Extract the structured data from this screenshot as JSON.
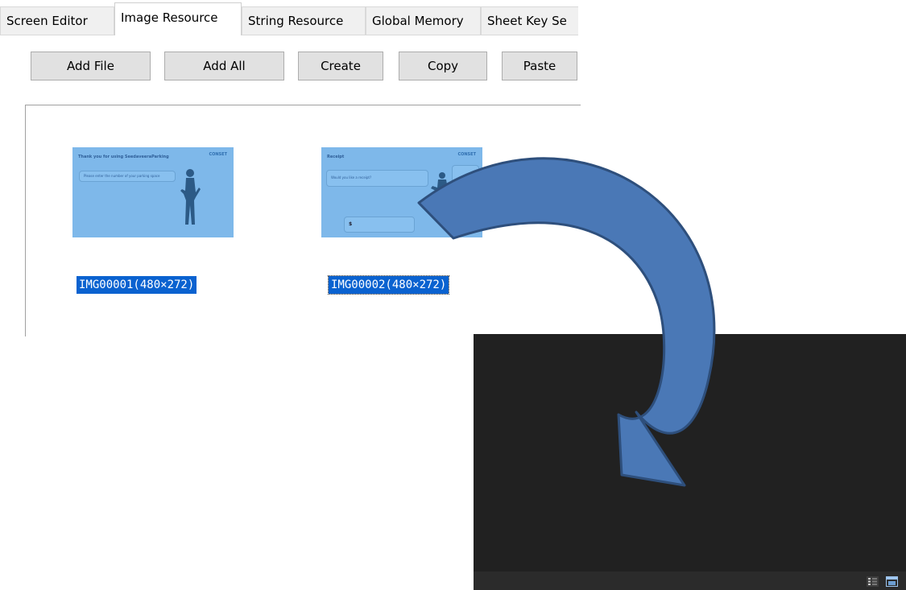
{
  "tabs": [
    {
      "label": "Screen Editor"
    },
    {
      "label": "Image Resource"
    },
    {
      "label": "String Resource"
    },
    {
      "label": "Global Memory"
    },
    {
      "label": "Sheet Key Se"
    }
  ],
  "toolbar": {
    "add_file": "Add File",
    "add_all": "Add All",
    "create": "Create",
    "copy": "Copy",
    "paste": "Paste"
  },
  "images": [
    {
      "caption": "IMG00001(480×272)",
      "preview_title": "Thank you for using SeedaveeraParking",
      "preview_brand": "CONSET",
      "preview_text": "Please enter the number of your parking space"
    },
    {
      "caption": "IMG00002(480×272)",
      "preview_title": "Receipt",
      "preview_brand": "CONSET",
      "preview_text": "Would you like a receipt?",
      "preview_amount": "$"
    }
  ],
  "colors": {
    "selection": "#0a62d0",
    "thumbnail_bg": "#7eb8ea",
    "arrow_fill": "#4a78b6",
    "arrow_stroke": "#2e4f7c",
    "dark_window": "#212121"
  },
  "icons": {
    "transfer_arrow": "curved-arrow-icon",
    "list_view": "list-view-icon",
    "window": "window-icon"
  }
}
